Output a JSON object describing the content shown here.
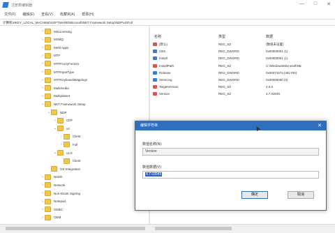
{
  "window": {
    "title": "注册表编辑器",
    "controls": [
      "—",
      "□",
      "✕"
    ]
  },
  "menu": [
    "文件(F)",
    "编辑(E)",
    "查看(V)",
    "收藏夹(A)",
    "帮助(H)"
  ],
  "address": "计算机\\HKEY_LOCAL_MACHINE\\SOFTWARE\\Microsoft\\NET Framework Setup\\NDP\\v4\\Full",
  "tree": [
    {
      "label": "MSLicensing",
      "expander": "›",
      "indent": 0
    },
    {
      "label": "MSMQ",
      "expander": "›",
      "indent": 0
    },
    {
      "label": "MSN Apps",
      "expander": "›",
      "indent": 0
    },
    {
      "label": "MTF",
      "expander": "›",
      "indent": 0
    },
    {
      "label": "MTFFuzzyFactors",
      "expander": "›",
      "indent": 0
    },
    {
      "label": "MTFInputType",
      "expander": "›",
      "indent": 0
    },
    {
      "label": "MTFKeyboardMappings",
      "expander": "›",
      "indent": 0
    },
    {
      "label": "Multimedia",
      "expander": "›",
      "indent": 0
    },
    {
      "label": "Multiplatnet",
      "expander": "›",
      "indent": 0
    },
    {
      "label": "NET Framework Setup",
      "expander": "⌄",
      "indent": 0
    },
    {
      "label": "NDP",
      "expander": "⌄",
      "indent": 1
    },
    {
      "label": "CDF",
      "expander": "›",
      "indent": 2
    },
    {
      "label": "v4",
      "expander": "⌄",
      "indent": 2
    },
    {
      "label": "Client",
      "expander": "›",
      "indent": 3
    },
    {
      "label": "Full",
      "expander": "›",
      "indent": 3
    },
    {
      "label": "v4.0",
      "expander": "⌄",
      "indent": 2
    },
    {
      "label": "Client",
      "expander": "",
      "indent": 3
    },
    {
      "label": "OS Integration",
      "expander": "",
      "indent": 1
    },
    {
      "label": "NetSh",
      "expander": "›",
      "indent": 0
    },
    {
      "label": "Network",
      "expander": "›",
      "indent": 0
    },
    {
      "label": "Non-Driver Signing",
      "expander": "›",
      "indent": 0
    },
    {
      "label": "Notepad",
      "expander": "›",
      "indent": 0
    },
    {
      "label": "ODBC",
      "expander": "›",
      "indent": 0
    },
    {
      "label": "OEM",
      "expander": "›",
      "indent": 0
    }
  ],
  "columns": {
    "name": "名称",
    "type": "类型",
    "data": "数据"
  },
  "values": [
    {
      "name": "(默认)",
      "type": "REG_SZ",
      "data": "(数值未设置)",
      "icon": "ab"
    },
    {
      "name": "CBS",
      "type": "REG_DWORD",
      "data": "0x00000001 (1)",
      "icon": "bin"
    },
    {
      "name": "Install",
      "type": "REG_DWORD",
      "data": "0x00000001 (1)",
      "icon": "bin"
    },
    {
      "name": "InstallPath",
      "type": "REG_SZ",
      "data": "C:\\Windows\\Microsoft\\NE",
      "icon": "ab"
    },
    {
      "name": "Release",
      "type": "REG_DWORD",
      "data": "0x00071b7a (461700)",
      "icon": "bin"
    },
    {
      "name": "Servicing",
      "type": "REG_DWORD",
      "data": "0x00000000 (0)",
      "icon": "bin"
    },
    {
      "name": "TargetVersion",
      "type": "REG_SZ",
      "data": "4.0.0",
      "icon": "ab"
    },
    {
      "name": "Version",
      "type": "REG_SZ",
      "data": "4.7.03045",
      "icon": "ab"
    }
  ],
  "dialog": {
    "title": "编辑字符串",
    "close": "✕",
    "name_label": "数值名称(N):",
    "name_value": "Version",
    "data_label": "数值数据(V):",
    "data_value": "4.7.03045",
    "ok": "确定",
    "cancel": "取消"
  }
}
